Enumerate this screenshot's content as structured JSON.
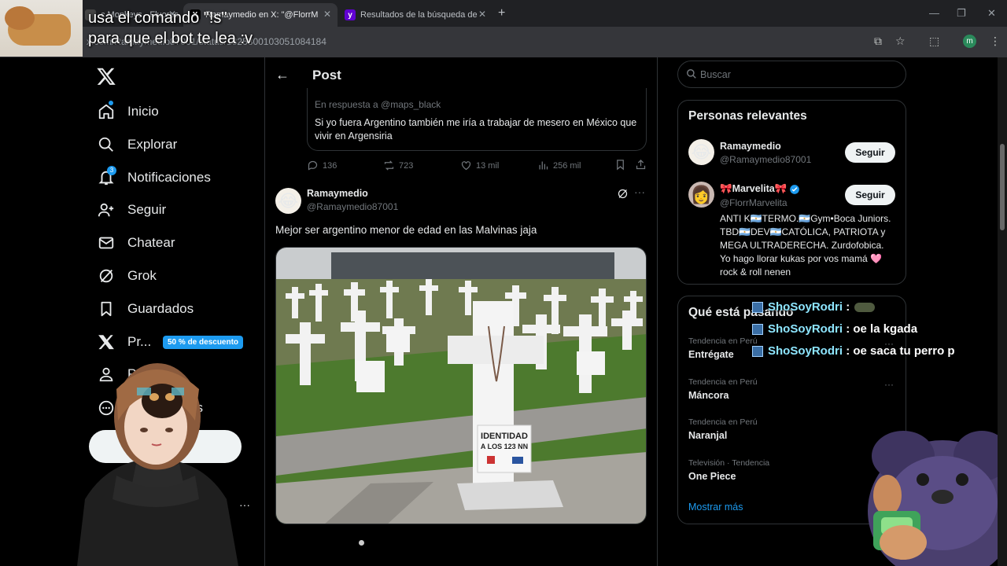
{
  "browser": {
    "tabs": [
      {
        "title": "c Monkeys - Fluores",
        "favicon": "monkey-favicon"
      },
      {
        "title": "Ramaymedio en X: \"@FlorrM",
        "favicon": "x-favicon"
      },
      {
        "title": "Resultados de la búsqueda de",
        "favicon": "yahoo-favicon"
      }
    ],
    "url": "x.com/Ramaymedio87001/status/1825300103051084184",
    "profile_initial": "m"
  },
  "overlay": {
    "command_line1": "usa el comando \"!s\"",
    "command_line2": "para que el bot te lea :v"
  },
  "nav": {
    "items": [
      {
        "label": "Inicio",
        "icon": "home-icon"
      },
      {
        "label": "Explorar",
        "icon": "search-icon"
      },
      {
        "label": "Notificaciones",
        "icon": "bell-icon"
      },
      {
        "label": "Seguir",
        "icon": "follow-icon"
      },
      {
        "label": "Chatear",
        "icon": "mail-icon"
      },
      {
        "label": "Grok",
        "icon": "grok-icon"
      },
      {
        "label": "Guardados",
        "icon": "bookmark-icon"
      },
      {
        "label": "Pr...",
        "icon": "x-premium-icon"
      },
      {
        "label": "P",
        "icon": "profile-icon"
      },
      {
        "label": "es",
        "icon": "more-circle-icon"
      }
    ],
    "notifications_count": "3",
    "promo_badge": "50 % de descuento",
    "more_dots": "···"
  },
  "post": {
    "header_title": "Post",
    "quoted": {
      "reply_to": "En respuesta a @maps_black",
      "text": "Si yo fuera Argentino también me iría a trabajar de mesero en México que vivir en Argensiria"
    },
    "actions": {
      "replies": "136",
      "retweets": "723",
      "likes": "13 mil",
      "views": "256 mil"
    },
    "tweet": {
      "avatar_emoji": "😂",
      "name": "Ramaymedio",
      "handle": "@Ramaymedio87001",
      "text": "Mejor ser argentino menor de edad en las Malvinas jaja",
      "image_sign_line1": "IDENTIDAD",
      "image_sign_line2": "A LOS 123 NN"
    }
  },
  "sidebar": {
    "search_placeholder": "Buscar",
    "relevant_title": "Personas relevantes",
    "people": [
      {
        "avatar_emoji": "😂",
        "name": "Ramaymedio",
        "handle": "@Ramaymedio87001",
        "follow": "Seguir"
      },
      {
        "avatar_emoji": "👩",
        "name": "🎀Marvelita🎀",
        "handle": "@FlorrMarvelita",
        "follow": "Seguir",
        "verified": true
      }
    ],
    "bio": "ANTI K🇦🇷TERMO.🇦🇷Gym•Boca Juniors. TBD🇦🇷DEV🇦🇷CATÓLICA, PATRIOTA y MEGA ULTRADERECHA. Zurdofobica. Yo hago llorar kukas por vos mamá 🩷 rock & roll nenen",
    "trending_title": "Qué está pasando",
    "trends": [
      {
        "meta": "Tendencia en Perú",
        "name": "Entrégate"
      },
      {
        "meta": "Tendencia en Perú",
        "name": "Máncora"
      },
      {
        "meta": "Tendencia en Perú",
        "name": "Naranjal"
      },
      {
        "meta": "Televisión · Tendencia",
        "name": "One Piece"
      }
    ],
    "show_more": "Mostrar más"
  },
  "chat": [
    {
      "user": "ShoSoyRodri",
      "message": ":"
    },
    {
      "user": "ShoSoyRodri",
      "message": ": oe la kgada"
    },
    {
      "user": "ShoSoyRodri",
      "message": ": oe saca tu perro p"
    }
  ],
  "colors": {
    "accent": "#1d9bf0",
    "background": "#000000",
    "border": "#2f3336",
    "muted_text": "#71767b"
  }
}
